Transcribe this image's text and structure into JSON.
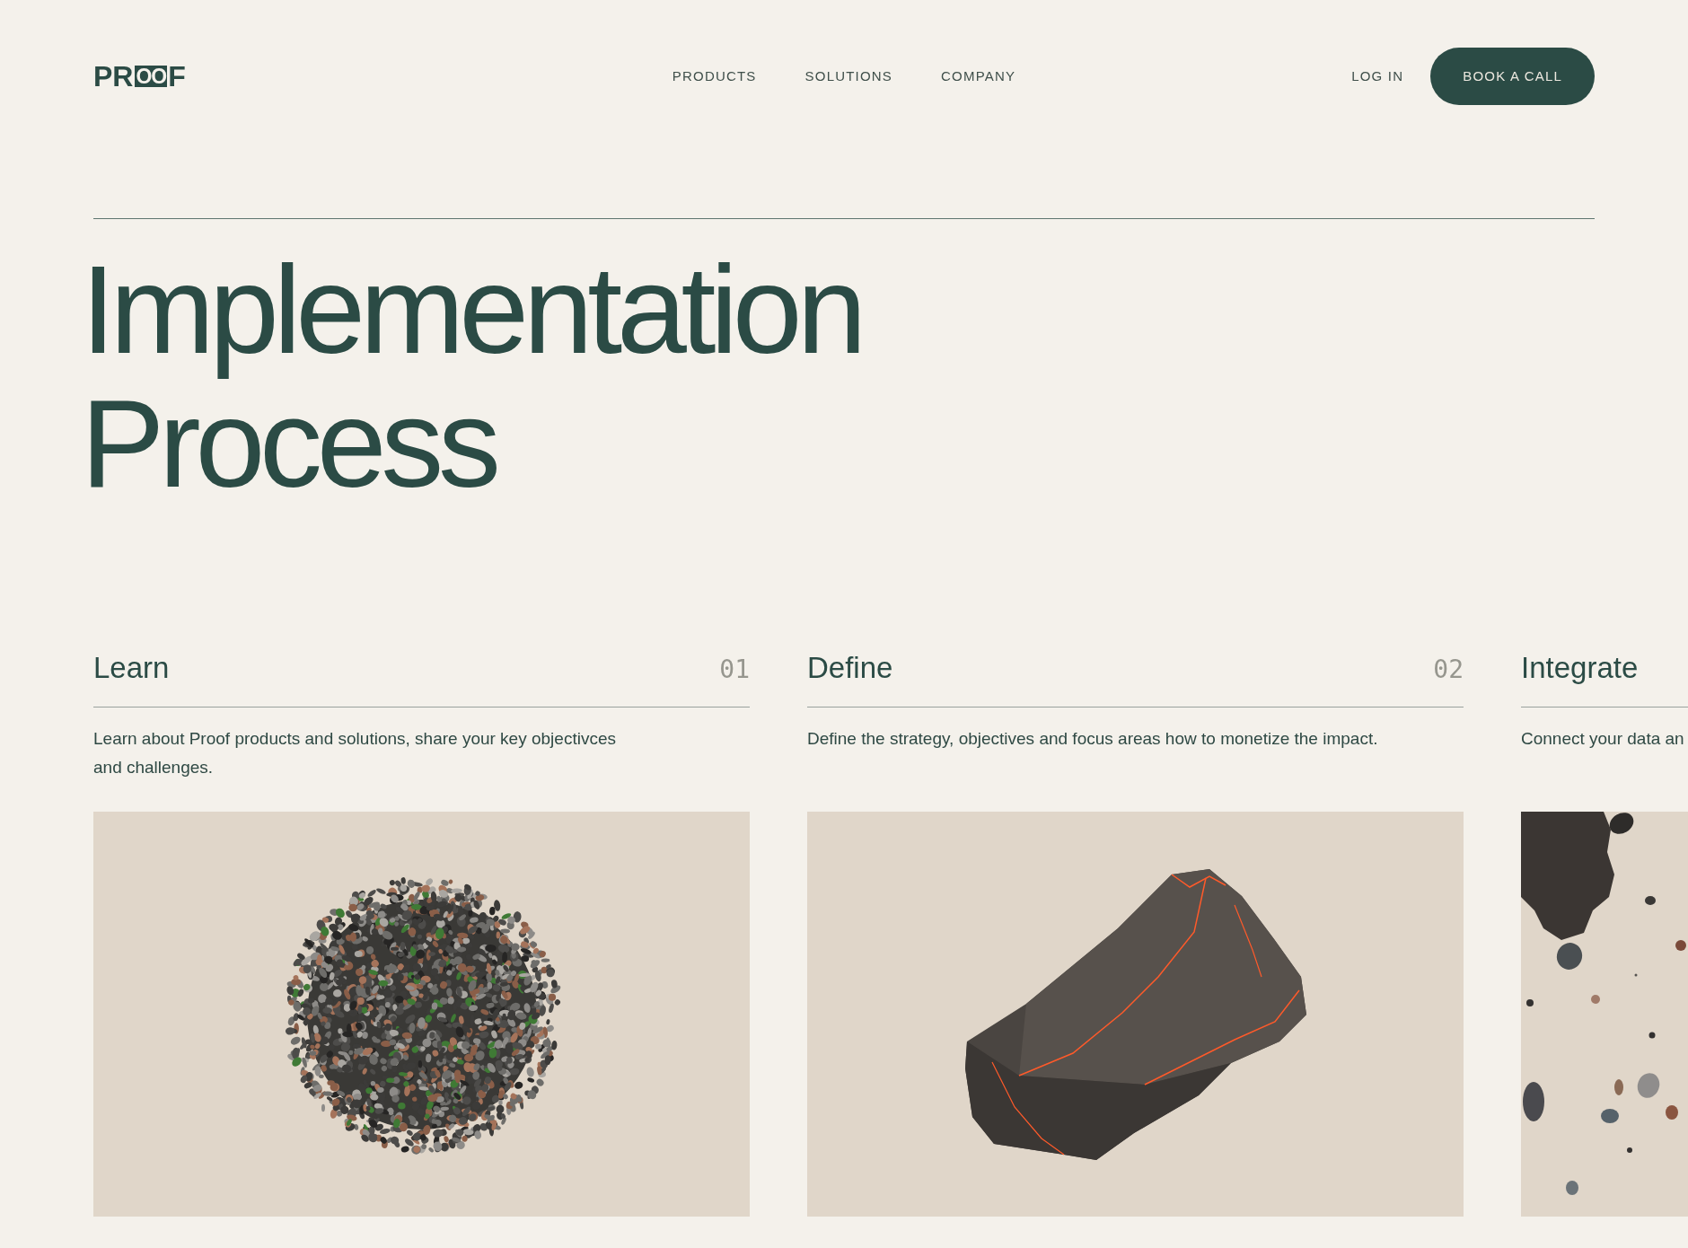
{
  "header": {
    "logo": {
      "lead": "PR",
      "mark": "OO",
      "tail": "F"
    },
    "nav": [
      {
        "label": "PRODUCTS"
      },
      {
        "label": "SOLUTIONS"
      },
      {
        "label": "COMPANY"
      }
    ],
    "login": "LOG IN",
    "cta": "BOOK A CALL"
  },
  "hero": {
    "title": "Implementation Process"
  },
  "steps": [
    {
      "title": "Learn",
      "number": "01",
      "description": "Learn about Proof products and solutions, share your key objectivces\nand challenges.",
      "kind": "sphere"
    },
    {
      "title": "Define",
      "number": "02",
      "description": "Define the strategy, objectives and focus areas how to monetize the impact.",
      "kind": "rock"
    },
    {
      "title": "Integrate",
      "description": "Connect your data an",
      "kind": "pebbles"
    }
  ]
}
